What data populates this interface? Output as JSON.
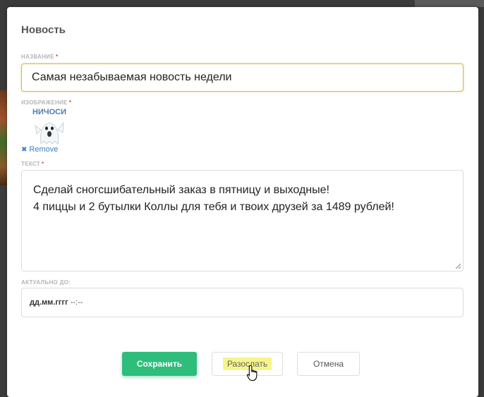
{
  "modal": {
    "title": "Новость"
  },
  "form": {
    "title_field": {
      "label": "НАЗВАНИЕ",
      "required_mark": "*",
      "value": "Самая незабываемая новость недели"
    },
    "image_field": {
      "label": "ИЗОБРАЖЕНИЕ",
      "required_mark": "*",
      "image_caption": "НИЧОСИ",
      "remove_label": "Remove",
      "remove_icon": "close-icon"
    },
    "text_field": {
      "label": "ТЕКСТ",
      "required_mark": "*",
      "lines": [
        "Сделай сногсшибательный заказ в пятницу и выходные!",
        "4 пиццы и 2 бутылки Коллы для тебя и твоих друзей за 1489 рублей!"
      ]
    },
    "date_field": {
      "label": "АКТУАЛЬНО ДО:",
      "placeholder_main": "дд.мм.гггг",
      "placeholder_time": "--:--"
    }
  },
  "buttons": {
    "save": "Сохранить",
    "send": "Разослать",
    "cancel": "Отмена"
  },
  "colors": {
    "accent_green": "#2fbd7c",
    "focus_border": "#d8b84a",
    "required": "#e04b4b",
    "link": "#3a7fc1",
    "highlight": "#f6f58a"
  }
}
